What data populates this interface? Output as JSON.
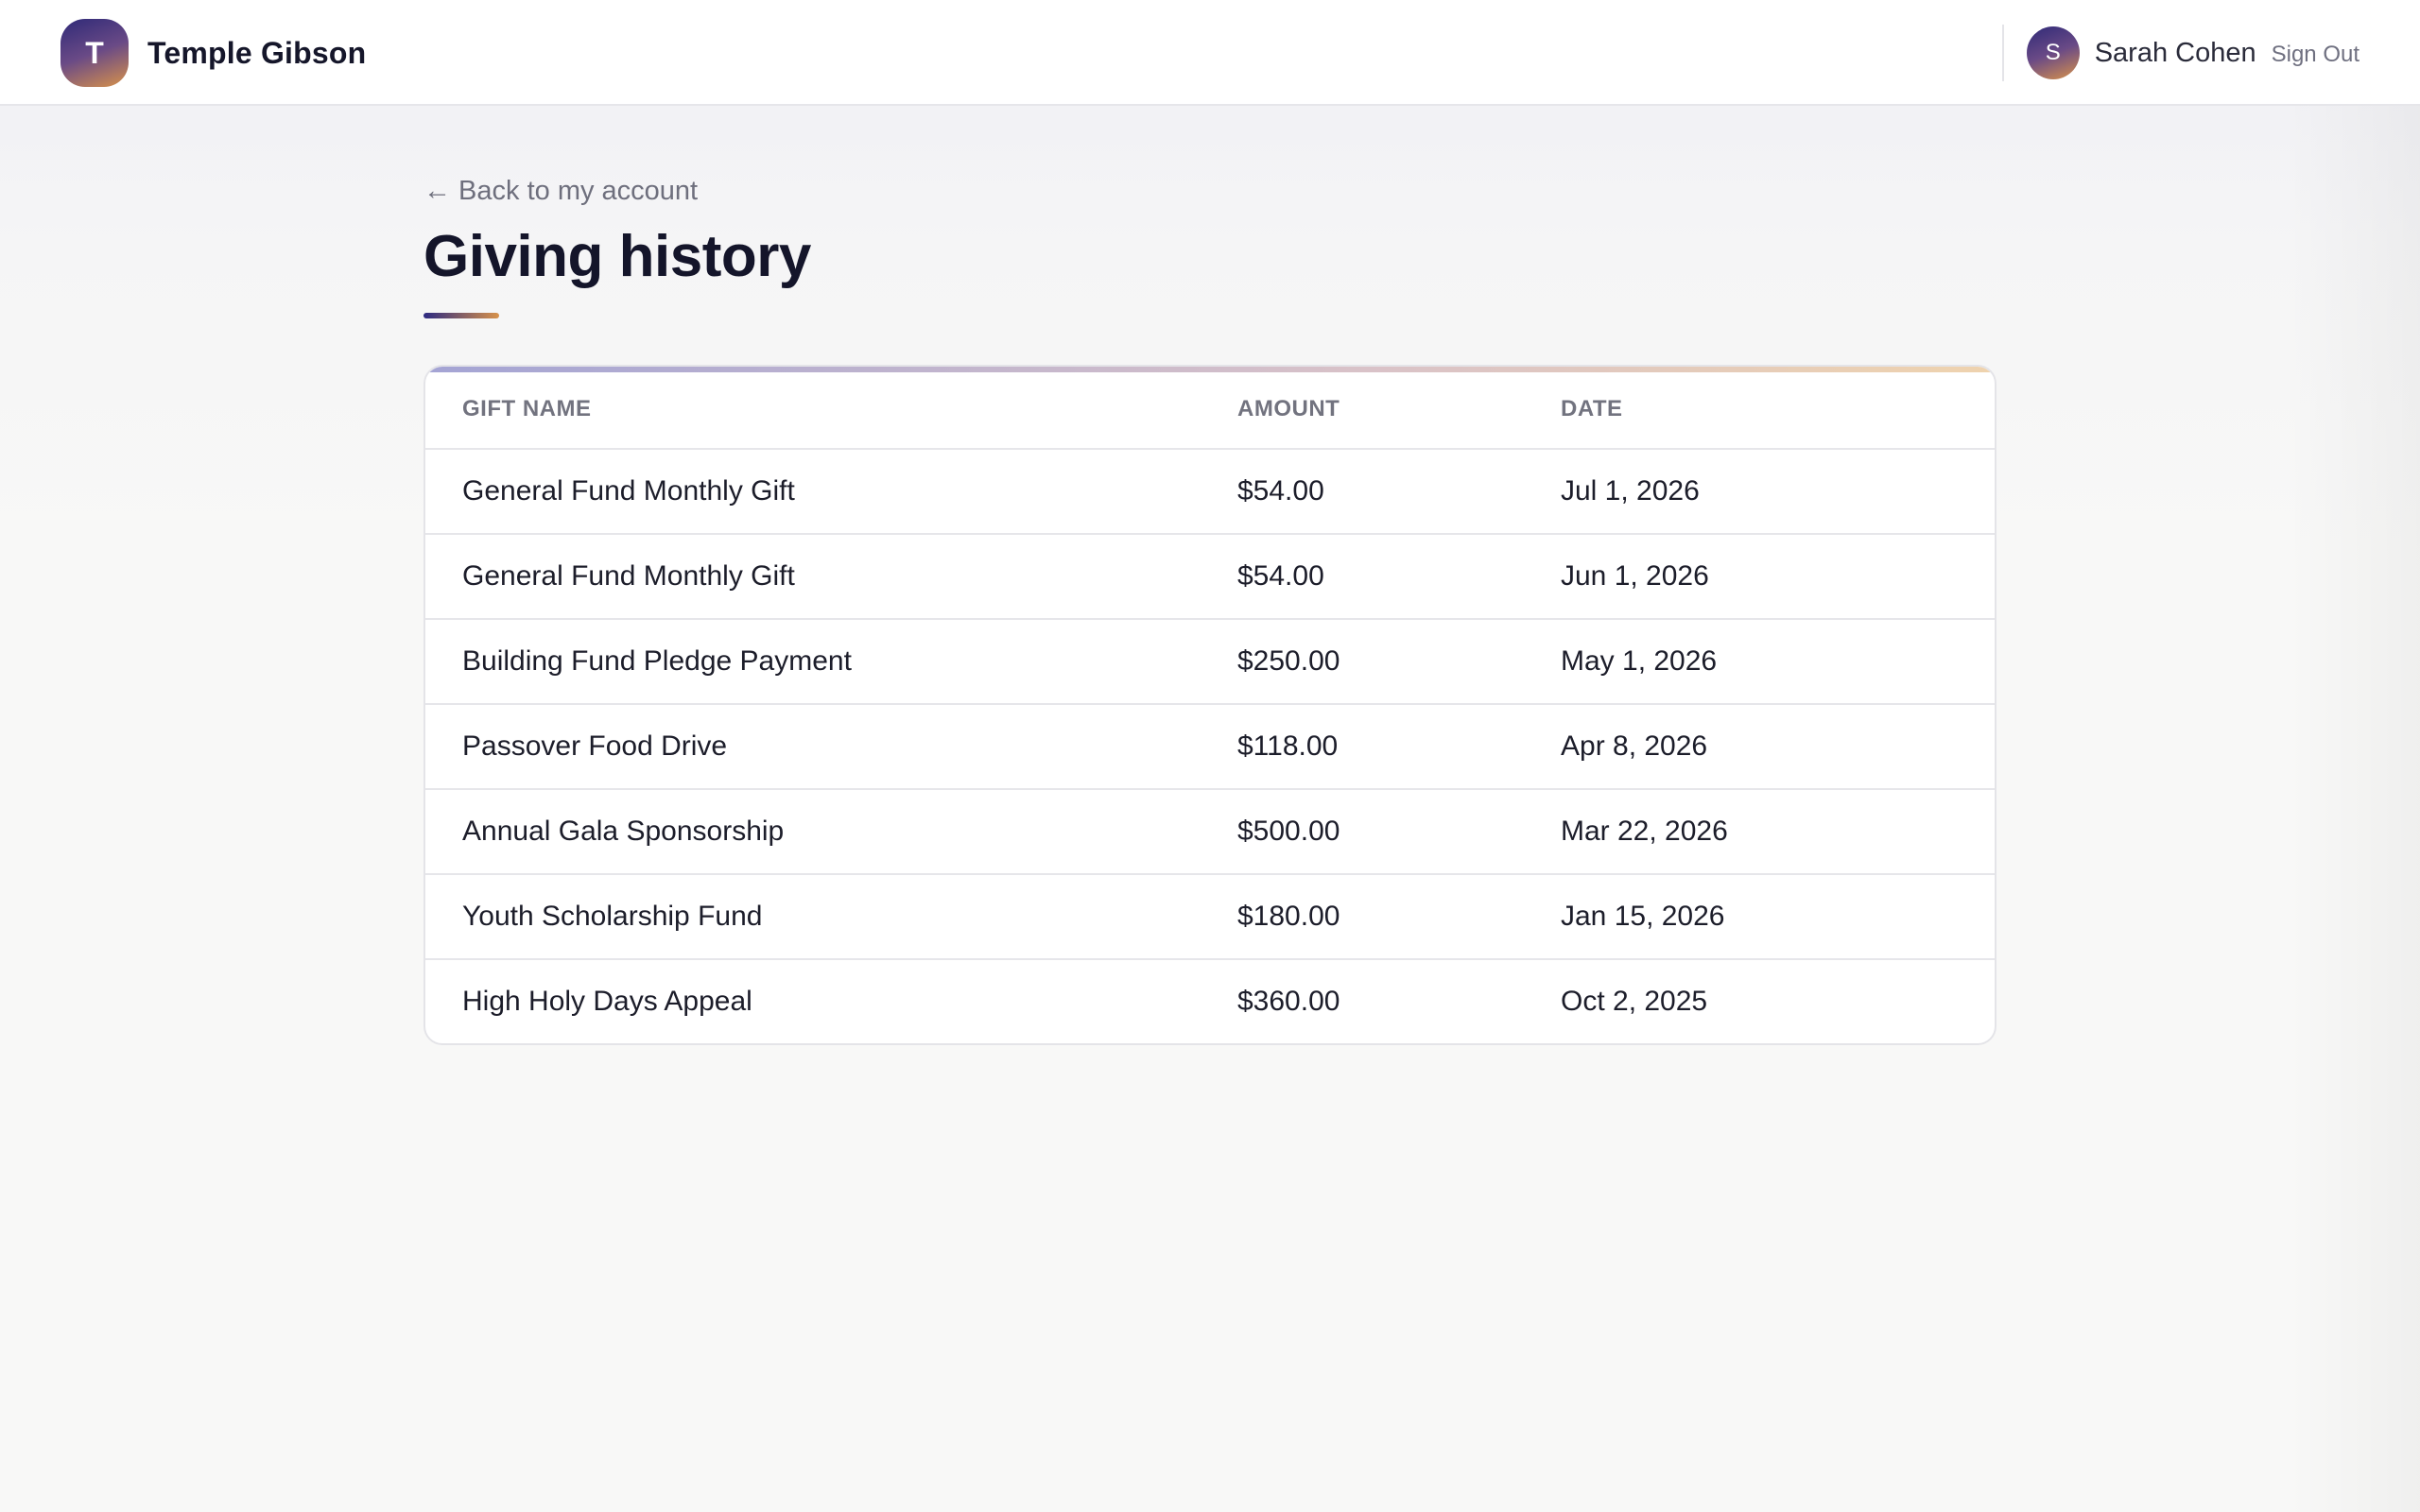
{
  "header": {
    "brand_initial": "T",
    "brand_name": "Temple Gibson",
    "user_initial": "S",
    "user_name": "Sarah Cohen",
    "sign_out_label": "Sign Out"
  },
  "main": {
    "back_link": "← Back to my account",
    "title": "Giving history"
  },
  "table": {
    "columns": [
      "GIFT NAME",
      "AMOUNT",
      "DATE"
    ],
    "rows": [
      {
        "gift": "General Fund Monthly Gift",
        "amount": "$54.00",
        "date": "Jul 1, 2026"
      },
      {
        "gift": "General Fund Monthly Gift",
        "amount": "$54.00",
        "date": "Jun 1, 2026"
      },
      {
        "gift": "Building Fund Pledge Payment",
        "amount": "$250.00",
        "date": "May 1, 2026"
      },
      {
        "gift": "Passover Food Drive",
        "amount": "$118.00",
        "date": "Apr 8, 2026"
      },
      {
        "gift": "Annual Gala Sponsorship",
        "amount": "$500.00",
        "date": "Mar 22, 2026"
      },
      {
        "gift": "Youth Scholarship Fund",
        "amount": "$180.00",
        "date": "Jan 15, 2026"
      },
      {
        "gift": "High Holy Days Appeal",
        "amount": "$360.00",
        "date": "Oct 2, 2025"
      }
    ]
  },
  "colors": {
    "brand_gradient_start": "#2f2a78",
    "brand_gradient_end": "#d8924a",
    "title_text": "#14152a",
    "muted_text": "#6e6f7d"
  }
}
